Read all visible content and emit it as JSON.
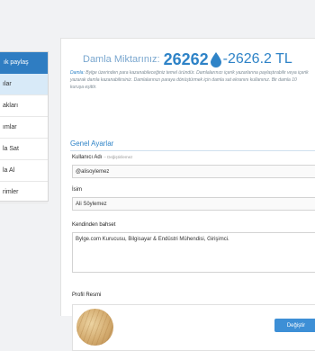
{
  "sidebar": {
    "header": "ık paylaş",
    "items": [
      "ılar",
      "akları",
      "ımlar",
      "la Sat",
      "la Al",
      "rimler"
    ],
    "active_index": 0
  },
  "balance": {
    "label": "Damla Miktarınız:",
    "value": "26262",
    "diff": "-2626.2 TL",
    "accent_color": "#2e83c7"
  },
  "notice": {
    "label": "Damla:",
    "text": "Bylge üzerinden para kazanabileceğiniz temel üründür. Damlalarınızı içerik yazarlarına paylaştırabilir veya içerik yazarak damla kazanabilirsiniz. Damlalarınızı paraya dönüştürmek için damla sat ekranını kullanınız. Bir damla 10 kuruşa eşittir."
  },
  "profile": {
    "section_title": "Genel Ayarlar",
    "username_label": "Kullanıcı Adı",
    "username_hint": "– Değiştirilemez",
    "username_value": "@alisoylemez",
    "name_label": "İsim",
    "name_value": "Ali Söylemez",
    "bio_label": "Kendinden bahset",
    "bio_value": "Bylge.com Kurucusu, Bilgisayar & Endüstri Mühendisi, Girişimci.",
    "photo_label": "Profil Resmi",
    "change_button": "Değiştir"
  }
}
